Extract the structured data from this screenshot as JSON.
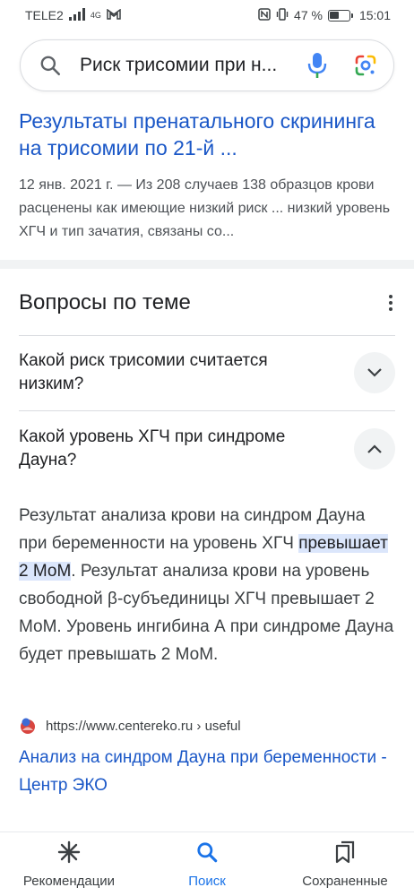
{
  "status_bar": {
    "carrier": "TELE2",
    "signal_sub": "4G",
    "battery_percent_label": "47 %",
    "battery_level": 0.47,
    "time": "15:01"
  },
  "search": {
    "query": "Риск трисомии при н..."
  },
  "result": {
    "title": "Результаты пренатального скрининга на трисомии по 21-й ...",
    "snippet": "12 янв. 2021 г. — Из 208 случаев 138 образцов крови расценены как имеющие низкий риск ... низкий уровень ХГЧ и тип зачатия, связаны со..."
  },
  "paa": {
    "title": "Вопросы по теме",
    "questions": [
      {
        "text": "Какой риск трисомии считается низким?"
      },
      {
        "text": "Какой уровень ХГЧ при синдроме Дауна?"
      }
    ],
    "answer": {
      "before": "Результат анализа крови на синдром Дауна при беременности на уровень ХГЧ ",
      "highlight": "превышает 2 МоМ",
      "after": ". Результат анализа крови на уровень свободной β-субъединицы ХГЧ превышает 2 МоМ. Уровень ингибина А при синдроме Дауна будет превышать 2 МоМ."
    },
    "source_url": "https://www.centereko.ru › useful",
    "source_title": "Анализ на синдром Дауна при беременности - Центр ЭКО"
  },
  "nav": {
    "items": [
      {
        "label": "Рекомендации",
        "icon": "asterisk-icon"
      },
      {
        "label": "Поиск",
        "icon": "search-icon"
      },
      {
        "label": "Сохраненные",
        "icon": "bookmarks-icon"
      }
    ]
  },
  "colors": {
    "link": "#1a57c7",
    "active_nav": "#1a73e8",
    "highlight_bg": "#dbe6fb"
  }
}
